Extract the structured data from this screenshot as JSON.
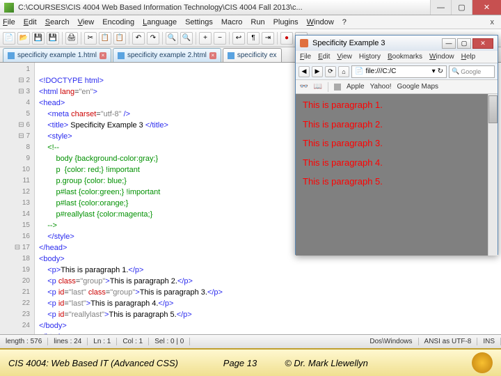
{
  "window": {
    "title": "C:\\COURSES\\CIS 4004   Web Based Information Technology\\CIS 4004   Fall 2013\\c..."
  },
  "menu": {
    "file": "File",
    "edit": "Edit",
    "search": "Search",
    "view": "View",
    "encoding": "Encoding",
    "language": "Language",
    "settings": "Settings",
    "macro": "Macro",
    "run": "Run",
    "plugins": "Plugins",
    "window": "Window",
    "help": "?",
    "close_all": "x"
  },
  "tabs": {
    "t1": "specificity example 1.html",
    "t2": "specificity example 2.html",
    "t3": "specificity ex"
  },
  "gutter_lines": [
    "1",
    "2",
    "3",
    "4",
    "5",
    "6",
    "7",
    "8",
    "9",
    "10",
    "11",
    "12",
    "13",
    "14",
    "15",
    "16",
    "17",
    "18",
    "19",
    "20",
    "21",
    "22",
    "23",
    "24"
  ],
  "code": {
    "l1a": "<!DOCTYPE html>",
    "l2a": "<html ",
    "l2b": "lang",
    "l2c": "=",
    "l2d": "\"en\"",
    "l2e": ">",
    "l3": "<head>",
    "l4a": "    <meta ",
    "l4b": "charset",
    "l4c": "=",
    "l4d": "\"utf-8\"",
    "l4e": " />",
    "l5a": "    <title>",
    "l5b": " Specificity Example 3 ",
    "l5c": "</title>",
    "l6": "    <style>",
    "l7": "    <!--",
    "l8": "        body {background-color:gray;}",
    "l9": "        p  {color: red;} !important",
    "l10": "        p.group {color: blue;}",
    "l11": "        p#last {color:green;} !important",
    "l12": "        p#last {color:orange;}",
    "l13": "        p#reallylast {color:magenta;}",
    "l14": "    -->",
    "l15": "    </style>",
    "l16": "</head>",
    "l17": "<body>",
    "l18a": "    <p>",
    "l18b": "This is paragraph 1.",
    "l18c": "</p>",
    "l19a": "    <p ",
    "l19b": "class",
    "l19c": "=",
    "l19d": "\"group\"",
    "l19e": ">",
    "l19f": "This is paragraph 2.",
    "l19g": "</p>",
    "l20a": "    <p ",
    "l20b": "id",
    "l20c": "=",
    "l20d": "\"last\"",
    "l20e": " class",
    "l20f": "=",
    "l20g": "\"group\"",
    "l20h": ">",
    "l20i": "This is paragraph 3.",
    "l20j": "</p>",
    "l21a": "    <p ",
    "l21b": "id",
    "l21c": "=",
    "l21d": "\"last\"",
    "l21e": ">",
    "l21f": "This is paragraph 4.",
    "l21g": "</p>",
    "l22a": "    <p ",
    "l22b": "id",
    "l22c": "=",
    "l22d": "\"reallylast\"",
    "l22e": ">",
    "l22f": "This is paragraph 5.",
    "l22g": "</p>",
    "l23": "</body>",
    "l24": "</html>"
  },
  "browser": {
    "title": "Specificity Example 3",
    "menu": {
      "file": "File",
      "edit": "Edit",
      "view": "View",
      "history": "History",
      "bookmarks": "Bookmarks",
      "window": "Window",
      "help": "Help"
    },
    "url_text": "file:///C:/C",
    "search_ph": "Google",
    "bookmarks": {
      "apple": "Apple",
      "yahoo": "Yahoo!",
      "gmaps": "Google Maps"
    },
    "p1": "This is paragraph 1.",
    "p2": "This is paragraph 2.",
    "p3": "This is paragraph 3.",
    "p4": "This is paragraph 4.",
    "p5": "This is paragraph 5."
  },
  "status": {
    "length": "length : 576",
    "lines": "lines : 24",
    "ln": "Ln : 1",
    "col": "Col : 1",
    "sel": "Sel : 0 | 0",
    "eol": "Dos\\Windows",
    "enc": "ANSI as UTF-8",
    "ins": "INS"
  },
  "footer": {
    "left": "CIS 4004: Web Based IT (Advanced CSS)",
    "center": "Page 13",
    "right": "© Dr. Mark Llewellyn"
  }
}
